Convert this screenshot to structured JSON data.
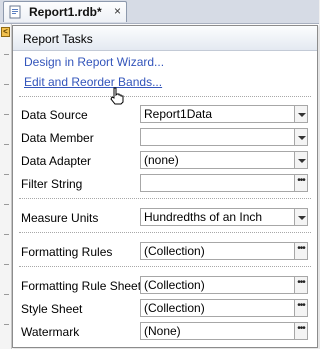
{
  "document_tab": {
    "title": "Report1.rdb*",
    "close_glyph": "×",
    "icon": "report-doc-icon"
  },
  "smart_tag": {
    "glyph": "<",
    "icon": "smart-tag-icon"
  },
  "tasks": {
    "title": "Report Tasks",
    "links": [
      {
        "label": "Design in Report Wizard...",
        "hover": false
      },
      {
        "label": "Edit and Reorder Bands...",
        "hover": true
      }
    ],
    "properties": [
      {
        "label": "Data Source",
        "value": "Report1Data",
        "control": "dropdown"
      },
      {
        "label": "Data Member",
        "value": "",
        "control": "dropdown"
      },
      {
        "label": "Data Adapter",
        "value": "(none)",
        "control": "dropdown"
      },
      {
        "label": "Filter String",
        "value": "",
        "control": "ellipsis"
      },
      {
        "label": "Measure Units",
        "value": "Hundredths of an Inch",
        "control": "dropdown"
      },
      {
        "label": "Formatting Rules",
        "value": "(Collection)",
        "control": "ellipsis"
      },
      {
        "label": "Formatting Rule Sheet",
        "value": "(Collection)",
        "control": "ellipsis"
      },
      {
        "label": "Style Sheet",
        "value": "(Collection)",
        "control": "ellipsis"
      },
      {
        "label": "Watermark",
        "value": "(None)",
        "control": "ellipsis"
      }
    ],
    "ellipsis_glyph": "•••"
  },
  "colors": {
    "link": "#3355bb",
    "header_bg": "#e4e9f1",
    "border": "#8c8c8c"
  }
}
